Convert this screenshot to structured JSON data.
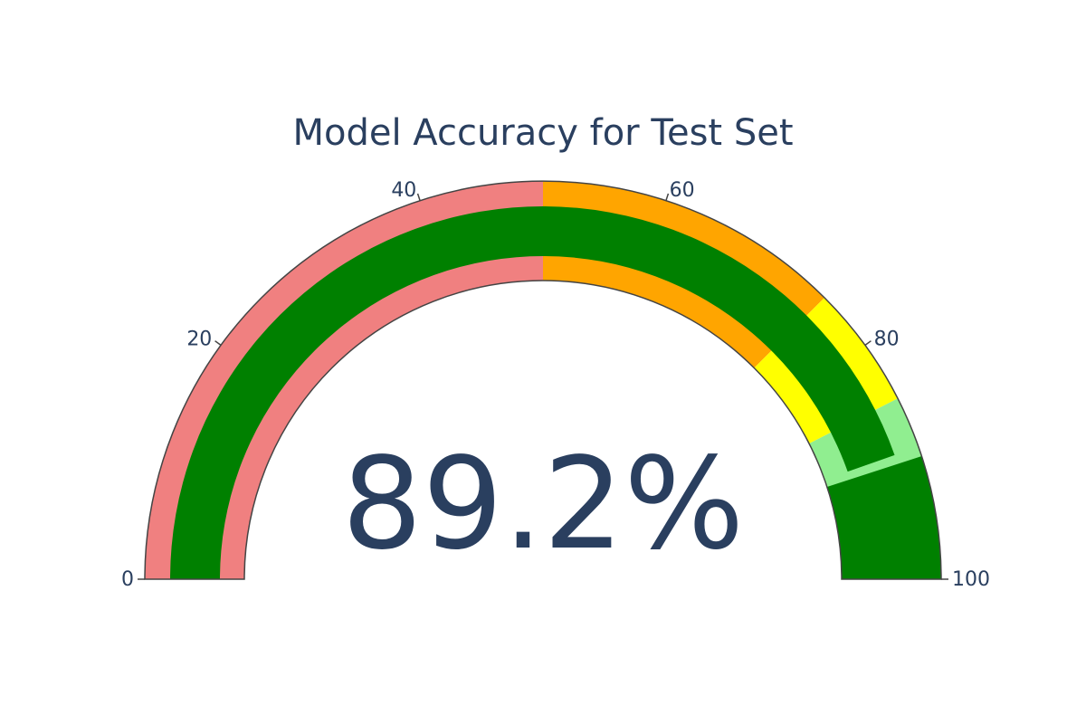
{
  "chart_data": {
    "type": "gauge",
    "title": "Model Accuracy for Test Set",
    "value": 89.2,
    "number_suffix": "%",
    "axis_range": [
      0,
      100
    ],
    "tick_values": [
      0,
      20,
      40,
      60,
      80,
      100
    ],
    "tick_labels": [
      "0",
      "20",
      "40",
      "60",
      "80",
      "100"
    ],
    "steps": [
      {
        "range": [
          0,
          50
        ],
        "color": "#F08080"
      },
      {
        "range": [
          50,
          75
        ],
        "color": "#FFA500"
      },
      {
        "range": [
          75,
          85
        ],
        "color": "#FFFF00"
      },
      {
        "range": [
          85,
          100
        ],
        "color": "#90EE90"
      }
    ],
    "bar_color": "#008000",
    "threshold": {
      "value": 90,
      "color": "#008000"
    },
    "text_color": "#2A3F5F",
    "outline_color": "#444444"
  }
}
